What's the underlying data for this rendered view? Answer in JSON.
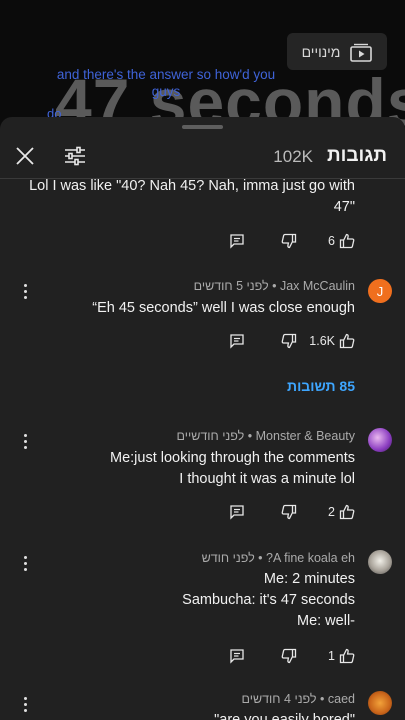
{
  "video": {
    "overlay_title": "47 seconds",
    "caption_line1": "and there's the answer so how'd you",
    "caption_line2": "guys",
    "caption_line3": "do",
    "subtitles_button_label": "מינויים"
  },
  "comments_panel": {
    "title": "תגובות",
    "count": "102K"
  },
  "comments": [
    {
      "author": "",
      "time": "",
      "lines": [
        "Lol I was like \"40? Nah 45? Nah, imma just go with",
        "47\""
      ],
      "likes": "6"
    },
    {
      "author": "Jax McCaulin",
      "time": "לפני 5 חודשים",
      "avatar_letter": "J",
      "lines": [
        "“Eh 45 seconds” well I was close enough"
      ],
      "likes": "1.6K",
      "replies_label": "85 תשובות"
    },
    {
      "author": "Monster & Beauty",
      "time": "לפני חודשיים",
      "lines": [
        "Me:just looking through the comments",
        "I thought it was a minute lol"
      ],
      "likes": "2"
    },
    {
      "author": "A fine koala eh?",
      "time": "לפני חודש",
      "lines": [
        "Me: 2 minutes",
        "Sambucha: it's 47 seconds",
        "Me: well-"
      ],
      "likes": "1"
    },
    {
      "author": "caed",
      "time": "לפני 4 חודשים",
      "lines": [
        "\"are you easily bored\""
      ],
      "likes": ""
    }
  ],
  "colors": {
    "sheet_bg": "#212121",
    "link_blue": "#3ea6ff",
    "avatar_orange": "#f06f1e"
  },
  "icons": {
    "close": "close-icon",
    "filter": "sort-filter-icon",
    "like": "thumbs-up-icon",
    "dislike": "thumbs-down-icon",
    "reply": "reply-comment-icon",
    "more": "more-vert-icon",
    "subscriptions": "subscriptions-icon"
  }
}
